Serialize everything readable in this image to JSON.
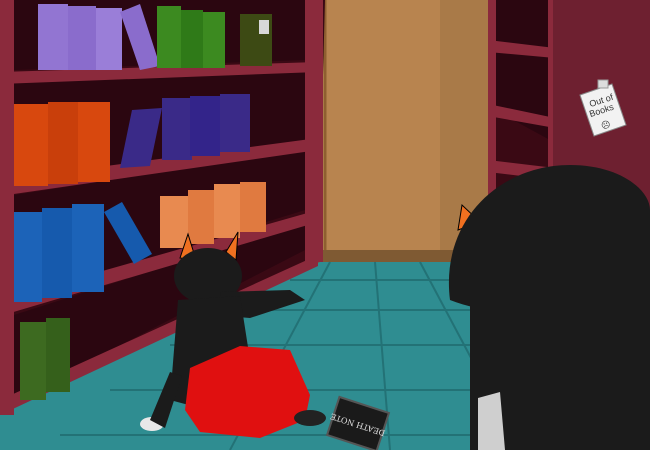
{
  "scene": {
    "note_text_line1": "Out of",
    "note_text_line2": "Books",
    "note_face": "☹",
    "book_cover_text": "DEATH NOTE"
  },
  "palette": {
    "shelf_wood": "#8a2b3a",
    "shelf_dark": "#2a0610",
    "wall": "#c89a6a",
    "door": "#b58552",
    "floor": "#2f8f93",
    "troll_black": "#1b1b1b",
    "troll_red": "#e01010",
    "horn_orange": "#f07020",
    "book_purple": "#8f6fd0",
    "book_green": "#3e8a20",
    "book_orange_red": "#d94a10",
    "book_indigo": "#3a2a8a",
    "book_blue": "#1a5fb8",
    "book_peach": "#e88a50",
    "book_olive": "#3e6a20"
  }
}
